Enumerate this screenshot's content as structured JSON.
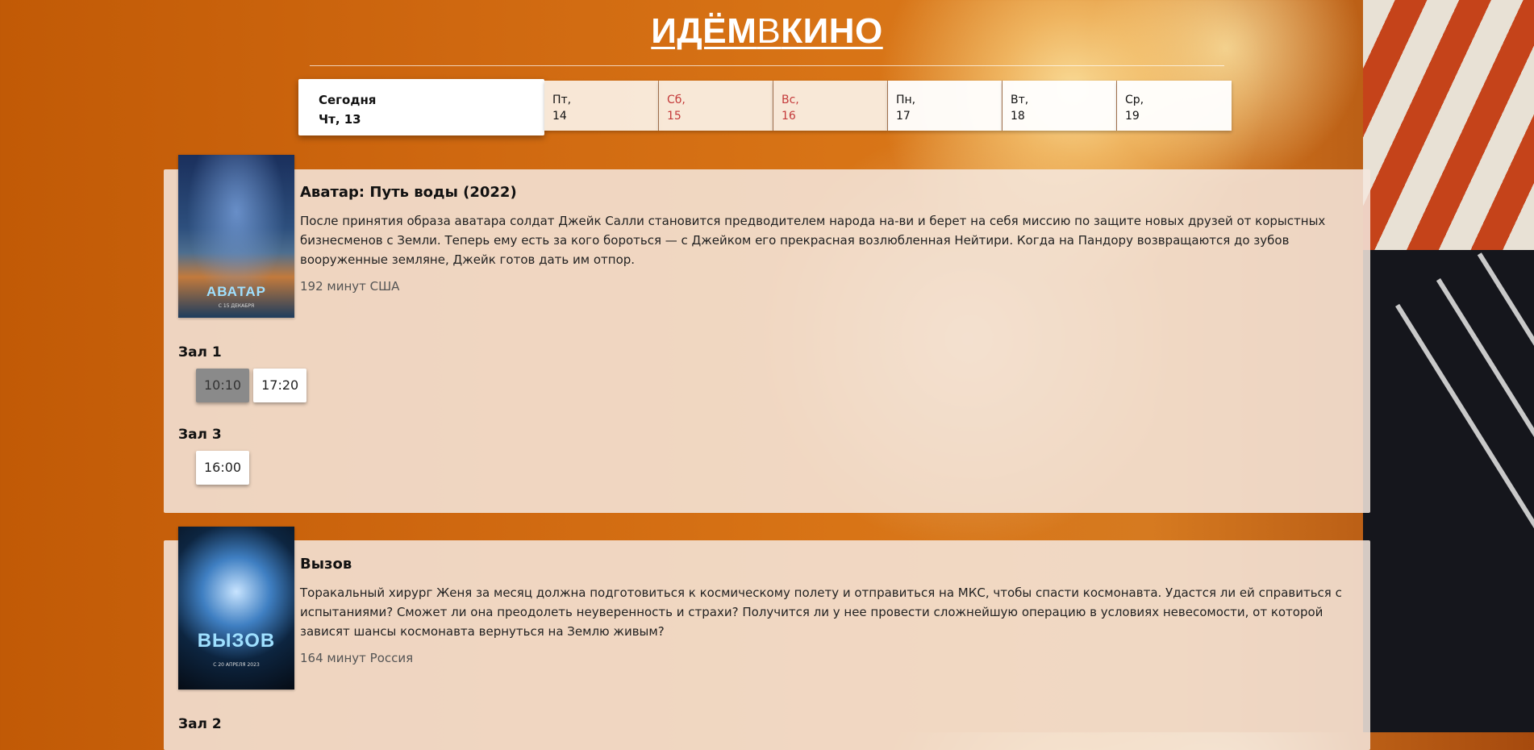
{
  "logo": {
    "part1": "ИДЁМ",
    "part2": "В",
    "part3": "КИНО"
  },
  "days": [
    {
      "name": "Сегодня",
      "number": "Чт, 13",
      "type": "today"
    },
    {
      "name": "Пт,",
      "number": "14",
      "type": "weekday"
    },
    {
      "name": "Сб,",
      "number": "15",
      "type": "weekend"
    },
    {
      "name": "Вс,",
      "number": "16",
      "type": "weekend"
    },
    {
      "name": "Пн,",
      "number": "17",
      "type": "weekday"
    },
    {
      "name": "Вт,",
      "number": "18",
      "type": "weekday"
    },
    {
      "name": "Ср,",
      "number": "19",
      "type": "weekday"
    }
  ],
  "movies": [
    {
      "title": "Аватар: Путь воды (2022)",
      "description": "После принятия образа аватара солдат Джейк Салли становится предводителем народа на-ви и берет на себя миссию по защите новых друзей от корыстных бизнесменов с Земли. Теперь ему есть за кого бороться — с Джейком его прекрасная возлюбленная Нейтири. Когда на Пандору возвращаются до зубов вооруженные земляне, Джейк готов дать им отпор.",
      "meta": "192 минут США",
      "poster_text": "АВАТАР",
      "poster_subtext": "С 15 ДЕКАБРЯ",
      "halls": [
        {
          "name": "Зал 1",
          "times": [
            {
              "time": "10:10",
              "past": true
            },
            {
              "time": "17:20",
              "past": false
            }
          ]
        },
        {
          "name": "Зал 3",
          "times": [
            {
              "time": "16:00",
              "past": false
            }
          ]
        }
      ]
    },
    {
      "title": "Вызов",
      "description": "Торакальный хирург Женя за месяц должна подготовиться к космическому полету и отправиться на МКС, чтобы спасти космонавта. Удастся ли ей справиться с испытаниями? Сможет ли она преодолеть неуверенность и страхи? Получится ли у нее провести сложнейшую операцию в условиях невесомости, от которой зависят шансы космонавта вернуться на Землю живым?",
      "meta": "164 минут Россия",
      "poster_text": "ВЫЗОВ",
      "poster_subtext": "С 20 АПРЕЛЯ 2023",
      "halls": [
        {
          "name": "Зал 2",
          "times": []
        }
      ]
    }
  ]
}
